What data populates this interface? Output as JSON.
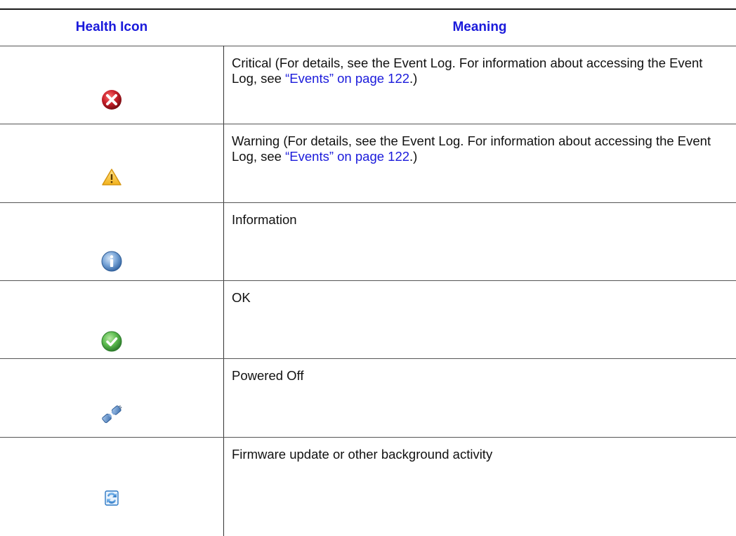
{
  "table": {
    "headers": {
      "icon": "Health Icon",
      "meaning": "Meaning"
    },
    "rows": [
      {
        "icon": "critical-icon",
        "text": "Critical (For details, see the Event Log. For information about accessing the Event Log, see ",
        "link": "“Events” on page 122",
        "suffix": ".)"
      },
      {
        "icon": "warning-icon",
        "text": "Warning (For details, see the Event Log. For information about accessing the Event Log, see ",
        "link": "“Events” on page 122",
        "suffix": ".)"
      },
      {
        "icon": "information-icon",
        "text": "Information",
        "link": "",
        "suffix": ""
      },
      {
        "icon": "ok-icon",
        "text": "OK",
        "link": "",
        "suffix": ""
      },
      {
        "icon": "powered-off-icon",
        "text": "Powered Off",
        "link": "",
        "suffix": ""
      },
      {
        "icon": "refresh-icon",
        "text": "Firmware update or other background activity",
        "link": "",
        "suffix": ""
      }
    ]
  },
  "colors": {
    "header": "#1a1adb",
    "link": "#1a1adb",
    "critical": "#c8202a",
    "warning": "#f2b21d",
    "information": "#4f86c6",
    "ok": "#3fa844",
    "powered_off": "#4a7fc1",
    "refresh": "#2d78c4"
  }
}
